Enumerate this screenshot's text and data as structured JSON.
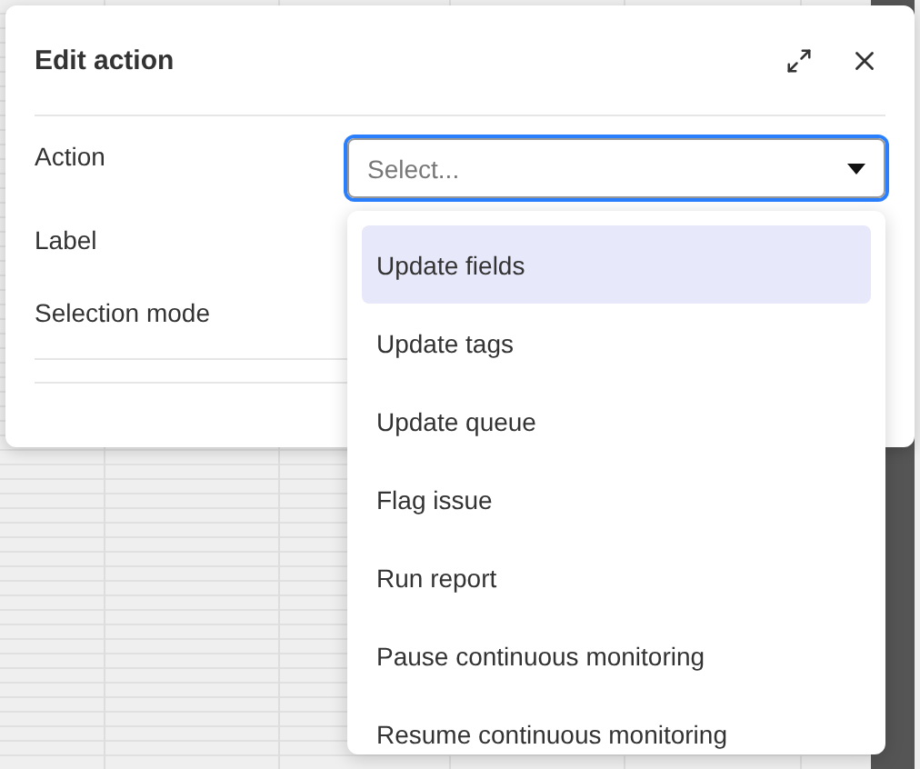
{
  "dialog": {
    "title": "Edit action",
    "fields": [
      {
        "label": "Action",
        "kind": "select",
        "placeholder": "Select...",
        "focused": true
      },
      {
        "label": "Label",
        "kind": "text"
      },
      {
        "label": "Selection mode",
        "kind": "text"
      }
    ]
  },
  "dropdown": {
    "options": [
      {
        "label": "Update fields",
        "selected": true
      },
      {
        "label": "Update tags",
        "selected": false
      },
      {
        "label": "Update queue",
        "selected": false
      },
      {
        "label": "Flag issue",
        "selected": false
      },
      {
        "label": "Run report",
        "selected": false
      },
      {
        "label": "Pause continuous monitoring",
        "selected": false
      },
      {
        "label": "Resume continuous monitoring",
        "selected": false
      }
    ]
  }
}
